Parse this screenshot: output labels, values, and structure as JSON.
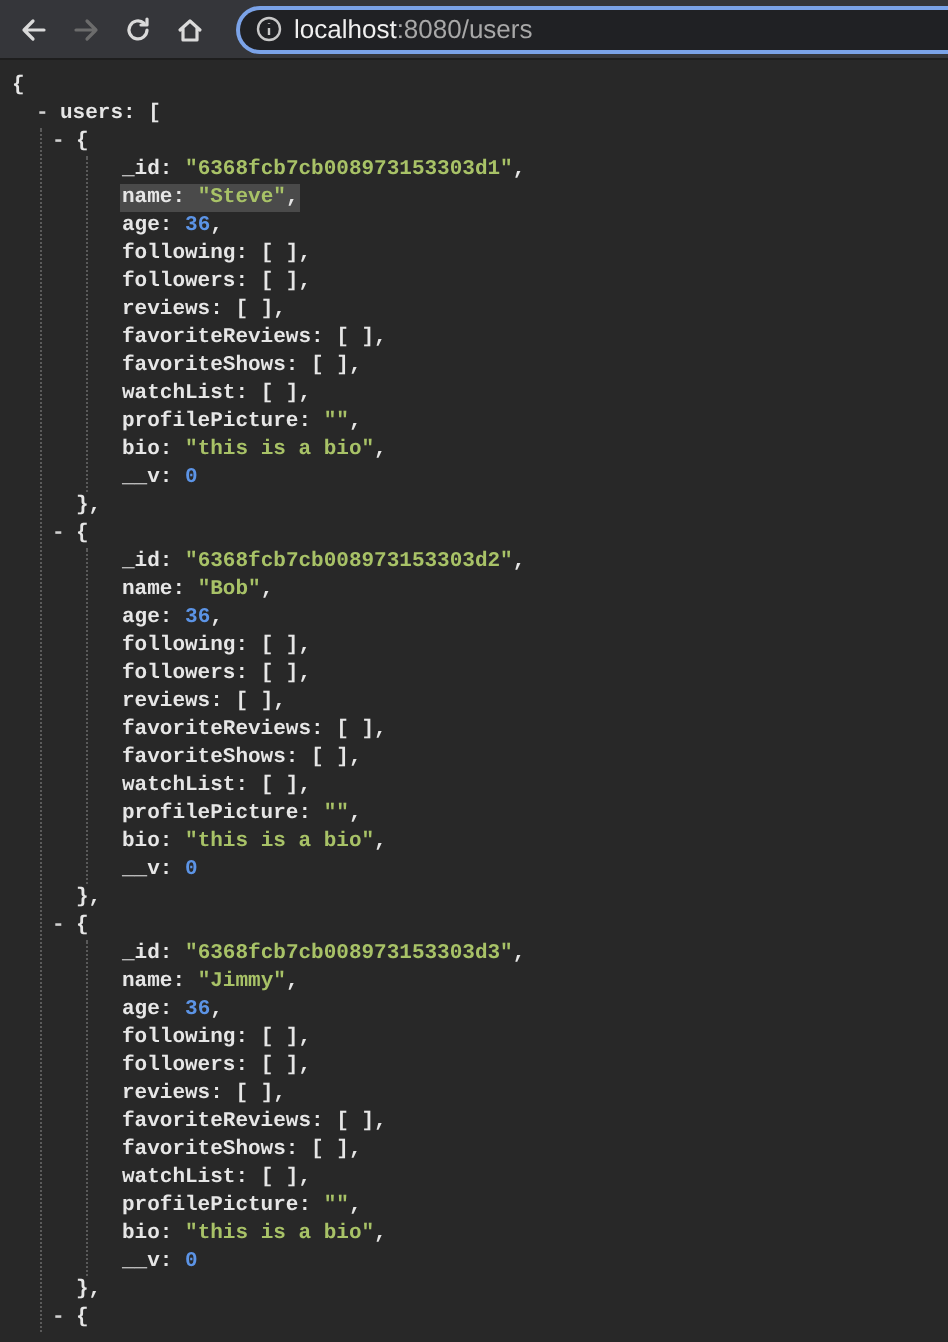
{
  "toolbar": {
    "buttons": [
      {
        "kind": "back",
        "disabled": false
      },
      {
        "kind": "forward",
        "disabled": true
      },
      {
        "kind": "reload",
        "disabled": false
      },
      {
        "kind": "home",
        "disabled": false
      }
    ]
  },
  "address": {
    "host": "localhost",
    "path": ":8080/users"
  },
  "document": {
    "open": "{",
    "root": {
      "toggle": "-",
      "key": "users:",
      "open": "["
    },
    "items": [
      {
        "toggle": "-",
        "open": "{",
        "close": "},",
        "fields": [
          {
            "key": "_id:",
            "value": "\"6368fcb7cb008973153303d1\"",
            "kind": "string",
            "punct": ",",
            "highlighted": false
          },
          {
            "key": "name:",
            "value": "\"Steve\"",
            "kind": "string",
            "punct": ",",
            "highlighted": true
          },
          {
            "key": "age:",
            "value": "36",
            "kind": "number",
            "punct": ",",
            "highlighted": false
          },
          {
            "key": "following:",
            "value": "[ ]",
            "kind": "array",
            "punct": ",",
            "highlighted": false
          },
          {
            "key": "followers:",
            "value": "[ ]",
            "kind": "array",
            "punct": ",",
            "highlighted": false
          },
          {
            "key": "reviews:",
            "value": "[ ]",
            "kind": "array",
            "punct": ",",
            "highlighted": false
          },
          {
            "key": "favoriteReviews:",
            "value": "[ ]",
            "kind": "array",
            "punct": ",",
            "highlighted": false
          },
          {
            "key": "favoriteShows:",
            "value": "[ ]",
            "kind": "array",
            "punct": ",",
            "highlighted": false
          },
          {
            "key": "watchList:",
            "value": "[ ]",
            "kind": "array",
            "punct": ",",
            "highlighted": false
          },
          {
            "key": "profilePicture:",
            "value": "\"\"",
            "kind": "string",
            "punct": ",",
            "highlighted": false
          },
          {
            "key": "bio:",
            "value": "\"this is a bio\"",
            "kind": "string",
            "punct": ",",
            "highlighted": false
          },
          {
            "key": "__v:",
            "value": "0",
            "kind": "number",
            "highlighted": false
          }
        ]
      },
      {
        "toggle": "-",
        "open": "{",
        "close": "},",
        "fields": [
          {
            "key": "_id:",
            "value": "\"6368fcb7cb008973153303d2\"",
            "kind": "string",
            "punct": ",",
            "highlighted": false
          },
          {
            "key": "name:",
            "value": "\"Bob\"",
            "kind": "string",
            "punct": ",",
            "highlighted": false
          },
          {
            "key": "age:",
            "value": "36",
            "kind": "number",
            "punct": ",",
            "highlighted": false
          },
          {
            "key": "following:",
            "value": "[ ]",
            "kind": "array",
            "punct": ",",
            "highlighted": false
          },
          {
            "key": "followers:",
            "value": "[ ]",
            "kind": "array",
            "punct": ",",
            "highlighted": false
          },
          {
            "key": "reviews:",
            "value": "[ ]",
            "kind": "array",
            "punct": ",",
            "highlighted": false
          },
          {
            "key": "favoriteReviews:",
            "value": "[ ]",
            "kind": "array",
            "punct": ",",
            "highlighted": false
          },
          {
            "key": "favoriteShows:",
            "value": "[ ]",
            "kind": "array",
            "punct": ",",
            "highlighted": false
          },
          {
            "key": "watchList:",
            "value": "[ ]",
            "kind": "array",
            "punct": ",",
            "highlighted": false
          },
          {
            "key": "profilePicture:",
            "value": "\"\"",
            "kind": "string",
            "punct": ",",
            "highlighted": false
          },
          {
            "key": "bio:",
            "value": "\"this is a bio\"",
            "kind": "string",
            "punct": ",",
            "highlighted": false
          },
          {
            "key": "__v:",
            "value": "0",
            "kind": "number",
            "highlighted": false
          }
        ]
      },
      {
        "toggle": "-",
        "open": "{",
        "close": "},",
        "fields": [
          {
            "key": "_id:",
            "value": "\"6368fcb7cb008973153303d3\"",
            "kind": "string",
            "punct": ",",
            "highlighted": false
          },
          {
            "key": "name:",
            "value": "\"Jimmy\"",
            "kind": "string",
            "punct": ",",
            "highlighted": false
          },
          {
            "key": "age:",
            "value": "36",
            "kind": "number",
            "punct": ",",
            "highlighted": false
          },
          {
            "key": "following:",
            "value": "[ ]",
            "kind": "array",
            "punct": ",",
            "highlighted": false
          },
          {
            "key": "followers:",
            "value": "[ ]",
            "kind": "array",
            "punct": ",",
            "highlighted": false
          },
          {
            "key": "reviews:",
            "value": "[ ]",
            "kind": "array",
            "punct": ",",
            "highlighted": false
          },
          {
            "key": "favoriteReviews:",
            "value": "[ ]",
            "kind": "array",
            "punct": ",",
            "highlighted": false
          },
          {
            "key": "favoriteShows:",
            "value": "[ ]",
            "kind": "array",
            "punct": ",",
            "highlighted": false
          },
          {
            "key": "watchList:",
            "value": "[ ]",
            "kind": "array",
            "punct": ",",
            "highlighted": false
          },
          {
            "key": "profilePicture:",
            "value": "\"\"",
            "kind": "string",
            "punct": ",",
            "highlighted": false
          },
          {
            "key": "bio:",
            "value": "\"this is a bio\"",
            "kind": "string",
            "punct": ",",
            "highlighted": false
          },
          {
            "key": "__v:",
            "value": "0",
            "kind": "number",
            "highlighted": false
          }
        ]
      },
      {
        "toggle": "-",
        "open": "{"
      }
    ]
  }
}
